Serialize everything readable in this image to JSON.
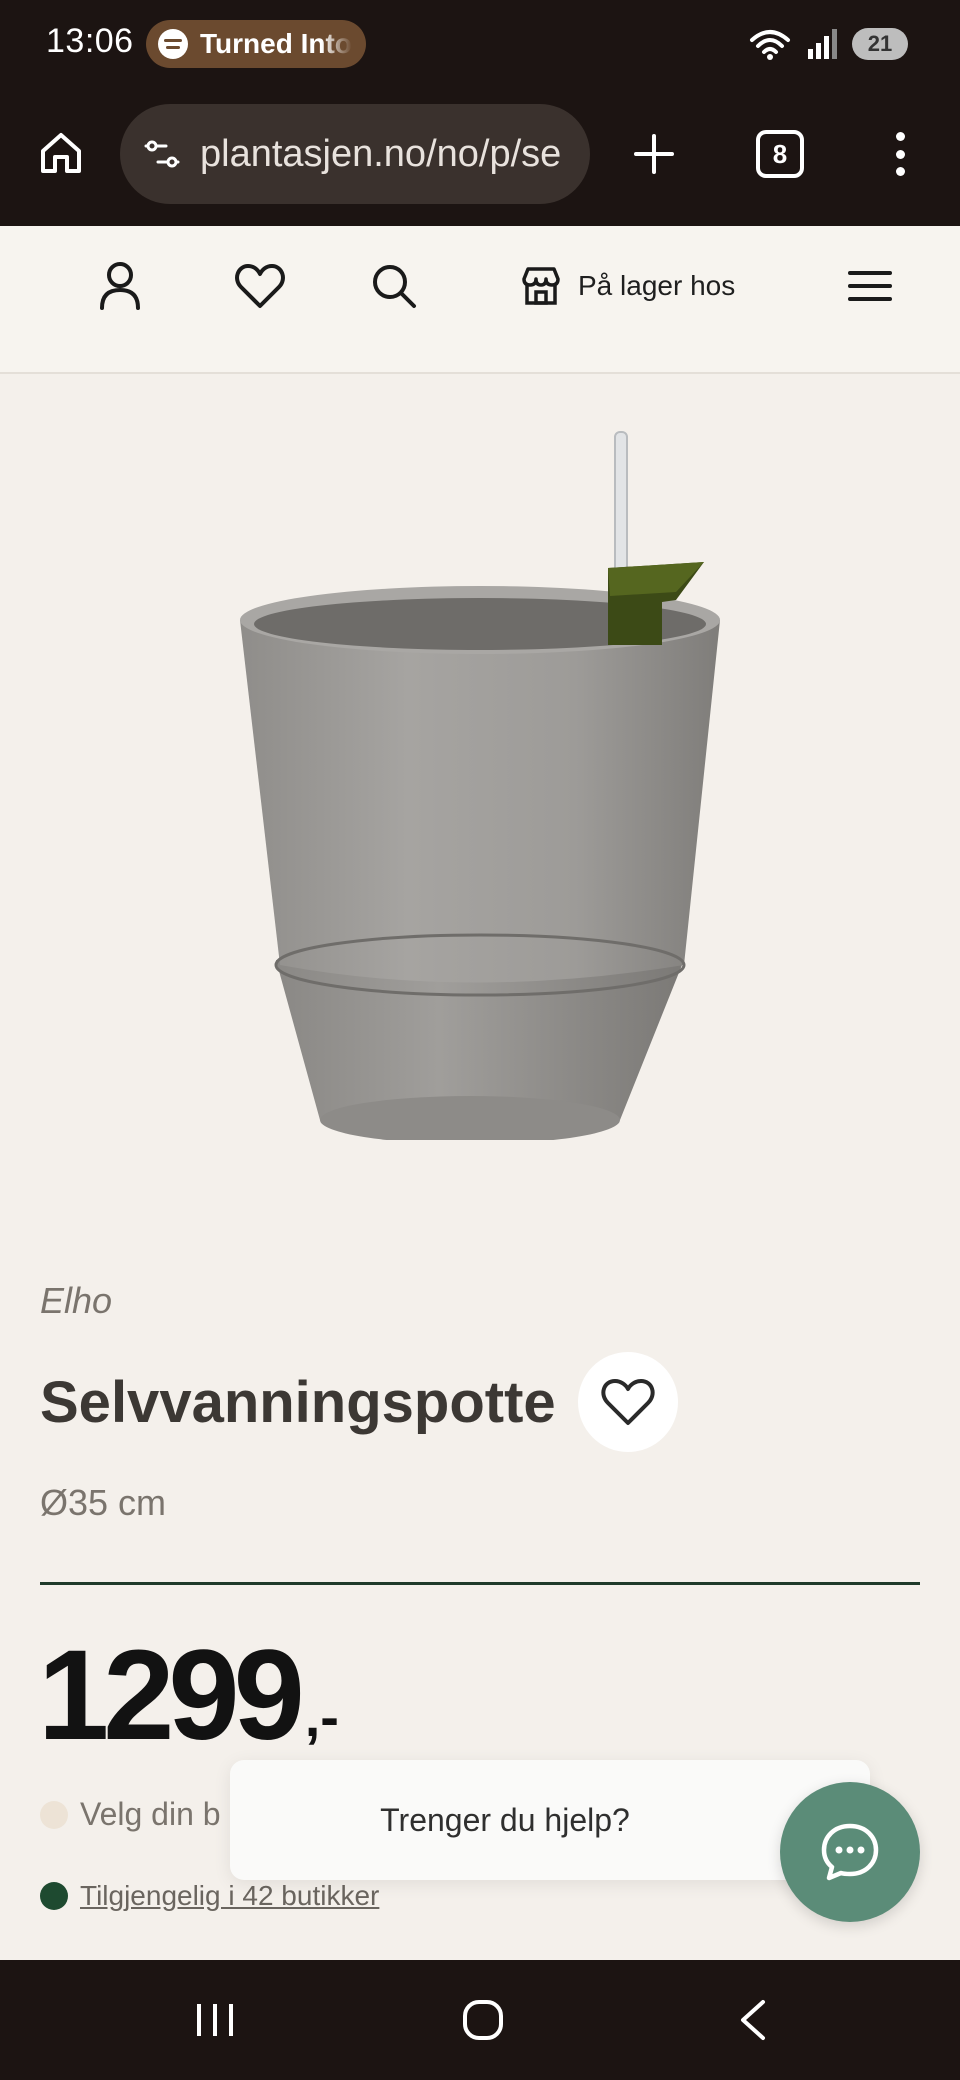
{
  "status_bar": {
    "time": "13:06",
    "media_pill": "Turned Into",
    "battery": "21"
  },
  "browser": {
    "url": "plantasjen.no/no/p/se",
    "tab_count": "8"
  },
  "site_header": {
    "store_label": "På lager hos"
  },
  "product": {
    "brand": "Elho",
    "title": "Selvvanningspotte",
    "size": "Ø35 cm",
    "price": "1299",
    "price_suffix": ",-",
    "store_prompt": "Velg din b",
    "availability": "Tilgjengelig i 42 butikker"
  },
  "help": {
    "label": "Trenger du hjelp?"
  },
  "colors": {
    "dark_bar": "#1c1412",
    "page_bg": "#f4f0eb",
    "accent_green": "#1f3a2a",
    "chat_green": "#5b8c78",
    "store_dot": "#ede3d6",
    "available_dot": "#1e4a30"
  }
}
